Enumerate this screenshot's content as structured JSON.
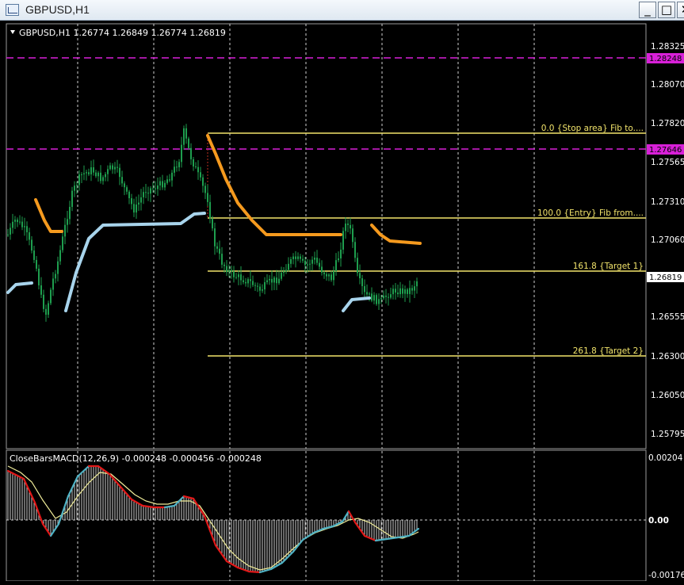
{
  "window": {
    "title": "GBPUSD,H1",
    "minimize_glyph": "_",
    "maximize_glyph": "□",
    "close_glyph": "✕"
  },
  "main_chart": {
    "info": "GBPUSD,H1  1.26774 1.26849 1.26774 1.26819",
    "price_labels": [
      "1.28325",
      "1.28070",
      "1.27820",
      "1.27565",
      "1.27310",
      "1.27060",
      "1.26555",
      "1.26300",
      "1.26050",
      "1.25795"
    ],
    "current_price": "1.26819",
    "level_a": "1.28248",
    "level_b": "1.27646",
    "fib_labels": {
      "stop": "0.0  {Stop area} Fib to....",
      "entry": "100.0 {Entry} Fib from....",
      "t1": "161.8  {Target 1}",
      "t2": "261.8   {Target  2}"
    },
    "colors": {
      "candle": "#1e9e4e",
      "fib": "#f2e46b",
      "magenta": "#d820d8",
      "orange": "#f59a1e",
      "lightblue": "#a8d4ec"
    }
  },
  "indicator": {
    "title": "CloseBarsMACD(12,26,9) -0.000248 -0.000456 -0.000248",
    "scale_top": "0.00204",
    "scale_zero": "0.00",
    "scale_bottom": "-0.00176"
  }
}
